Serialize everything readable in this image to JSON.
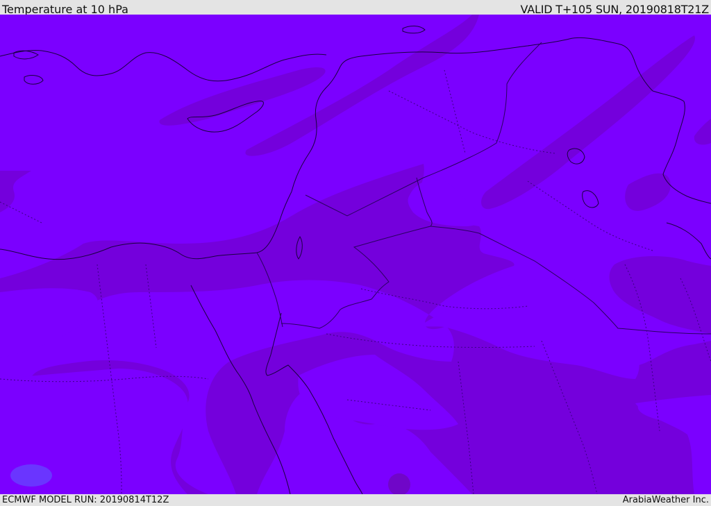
{
  "header": {
    "title": "Temperature at 10 hPa",
    "valid_time": "VALID T+105 SUN, 20190818T21Z"
  },
  "footer": {
    "model_run": "ECMWF MODEL RUN: 20190814T12Z",
    "brand": "ArabiaWeather Inc."
  },
  "map": {
    "field": "temperature-10hPa",
    "colors": {
      "base_shade": "#7b00ff",
      "darker_shade": "#7400dc",
      "cooler_spot": "#6a35ff",
      "coastline": "#1a0040",
      "border": "#2a0060"
    }
  }
}
